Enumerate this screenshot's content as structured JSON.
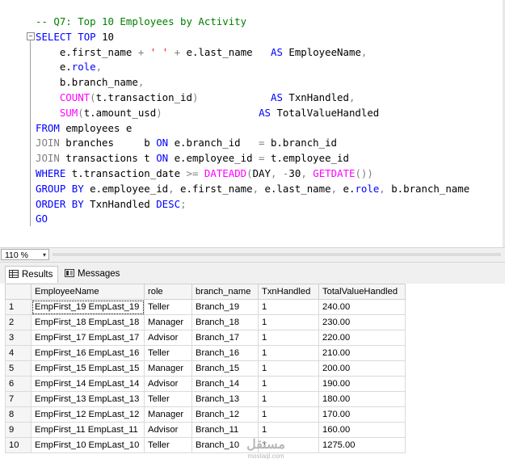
{
  "editor": {
    "lines": [
      [
        {
          "t": "-- Q7: Top 10 Employees by Activity",
          "c": "c"
        }
      ],
      [
        {
          "t": "SELECT",
          "c": "k"
        },
        {
          "t": " "
        },
        {
          "t": "TOP",
          "c": "k"
        },
        {
          "t": " 10"
        }
      ],
      [
        {
          "t": "    e.first_name "
        },
        {
          "t": "+",
          "c": "g"
        },
        {
          "t": " "
        },
        {
          "t": "' '",
          "c": "s"
        },
        {
          "t": " "
        },
        {
          "t": "+",
          "c": "g"
        },
        {
          "t": " e.last_name   "
        },
        {
          "t": "AS",
          "c": "k"
        },
        {
          "t": " EmployeeName"
        },
        {
          "t": ",",
          "c": "g"
        }
      ],
      [
        {
          "t": "    e."
        },
        {
          "t": "role",
          "c": "k"
        },
        {
          "t": ",",
          "c": "g"
        }
      ],
      [
        {
          "t": "    b.branch_name"
        },
        {
          "t": ",",
          "c": "g"
        }
      ],
      [
        {
          "t": "    "
        },
        {
          "t": "COUNT",
          "c": "f"
        },
        {
          "t": "(",
          "c": "g"
        },
        {
          "t": "t.transaction_id"
        },
        {
          "t": ")",
          "c": "g"
        },
        {
          "t": "            "
        },
        {
          "t": "AS",
          "c": "k"
        },
        {
          "t": " TxnHandled"
        },
        {
          "t": ",",
          "c": "g"
        }
      ],
      [
        {
          "t": "    "
        },
        {
          "t": "SUM",
          "c": "f"
        },
        {
          "t": "(",
          "c": "g"
        },
        {
          "t": "t.amount_usd"
        },
        {
          "t": ")",
          "c": "g"
        },
        {
          "t": "                "
        },
        {
          "t": "AS",
          "c": "k"
        },
        {
          "t": " TotalValueHandled"
        }
      ],
      [
        {
          "t": "FROM",
          "c": "k"
        },
        {
          "t": " employees e"
        }
      ],
      [
        {
          "t": "JOIN",
          "c": "g"
        },
        {
          "t": " branches     b "
        },
        {
          "t": "ON",
          "c": "k"
        },
        {
          "t": " e.branch_id   "
        },
        {
          "t": "=",
          "c": "g"
        },
        {
          "t": " b.branch_id"
        }
      ],
      [
        {
          "t": "JOIN",
          "c": "g"
        },
        {
          "t": " transactions t "
        },
        {
          "t": "ON",
          "c": "k"
        },
        {
          "t": " e.employee_id "
        },
        {
          "t": "=",
          "c": "g"
        },
        {
          "t": " t.employee_id"
        }
      ],
      [
        {
          "t": "WHERE",
          "c": "k"
        },
        {
          "t": " t.transaction_date "
        },
        {
          "t": ">=",
          "c": "g"
        },
        {
          "t": " "
        },
        {
          "t": "DATEADD",
          "c": "f"
        },
        {
          "t": "(",
          "c": "g"
        },
        {
          "t": "DAY"
        },
        {
          "t": ",",
          "c": "g"
        },
        {
          "t": " "
        },
        {
          "t": "-",
          "c": "g"
        },
        {
          "t": "30"
        },
        {
          "t": ",",
          "c": "g"
        },
        {
          "t": " "
        },
        {
          "t": "GETDATE",
          "c": "f"
        },
        {
          "t": "())",
          "c": "g"
        }
      ],
      [
        {
          "t": "GROUP BY",
          "c": "k"
        },
        {
          "t": " e.employee_id"
        },
        {
          "t": ",",
          "c": "g"
        },
        {
          "t": " e.first_name"
        },
        {
          "t": ",",
          "c": "g"
        },
        {
          "t": " e.last_name"
        },
        {
          "t": ",",
          "c": "g"
        },
        {
          "t": " e."
        },
        {
          "t": "role",
          "c": "k"
        },
        {
          "t": ",",
          "c": "g"
        },
        {
          "t": " b.branch_name"
        }
      ],
      [
        {
          "t": "ORDER BY",
          "c": "k"
        },
        {
          "t": " TxnHandled "
        },
        {
          "t": "DESC",
          "c": "k"
        },
        {
          "t": ";",
          "c": "g"
        }
      ],
      [
        {
          "t": "GO",
          "c": "k"
        }
      ]
    ],
    "collapse_glyph": "−"
  },
  "zoom": {
    "value": "110 %",
    "arrow": "▾"
  },
  "tabs": [
    {
      "label": "Results",
      "icon": "grid-icon",
      "active": true
    },
    {
      "label": "Messages",
      "icon": "messages-icon",
      "active": false
    }
  ],
  "results": {
    "columns": [
      "EmployeeName",
      "role",
      "branch_name",
      "TxnHandled",
      "TotalValueHandled"
    ],
    "rows": [
      [
        "1",
        "EmpFirst_19 EmpLast_19",
        "Teller",
        "Branch_19",
        "1",
        "240.00"
      ],
      [
        "2",
        "EmpFirst_18 EmpLast_18",
        "Manager",
        "Branch_18",
        "1",
        "230.00"
      ],
      [
        "3",
        "EmpFirst_17 EmpLast_17",
        "Advisor",
        "Branch_17",
        "1",
        "220.00"
      ],
      [
        "4",
        "EmpFirst_16 EmpLast_16",
        "Teller",
        "Branch_16",
        "1",
        "210.00"
      ],
      [
        "5",
        "EmpFirst_15 EmpLast_15",
        "Manager",
        "Branch_15",
        "1",
        "200.00"
      ],
      [
        "6",
        "EmpFirst_14 EmpLast_14",
        "Advisor",
        "Branch_14",
        "1",
        "190.00"
      ],
      [
        "7",
        "EmpFirst_13 EmpLast_13",
        "Teller",
        "Branch_13",
        "1",
        "180.00"
      ],
      [
        "8",
        "EmpFirst_12 EmpLast_12",
        "Manager",
        "Branch_12",
        "1",
        "170.00"
      ],
      [
        "9",
        "EmpFirst_11 EmpLast_11",
        "Advisor",
        "Branch_11",
        "1",
        "160.00"
      ],
      [
        "10",
        "EmpFirst_10 EmpLast_10",
        "Teller",
        "Branch_10",
        "1",
        "1275.00"
      ]
    ]
  },
  "watermark": {
    "main": "مستقل",
    "sub": "mostaql.com"
  }
}
